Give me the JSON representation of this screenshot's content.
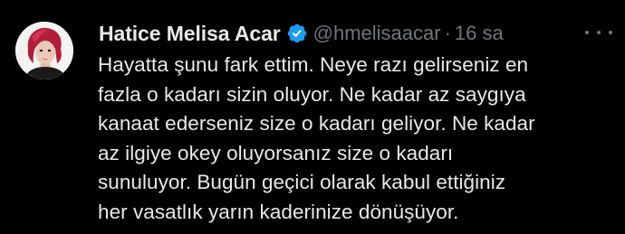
{
  "tweet": {
    "display_name": "Hatice Melisa Acar",
    "verified": true,
    "handle": "@hmelisaacar",
    "separator": "·",
    "time": "16 sa",
    "more_icon": "more-horizontal-icon",
    "text": "Hayatta şunu fark ettim. Neye razı gelirseniz en\nfazla o kadarı sizin oluyor. Ne kadar az saygıya\nkanaat ederseniz size o kadarı geliyor. Ne kadar\naz ilgiye okey oluyorsanız size o kadarı\nsunuluyor. Bugün geçici olarak kabul ettiğiniz\nher vasatlık yarın kaderinize dönüşüyor."
  },
  "colors": {
    "background": "#000000",
    "primary_text": "#e7e9ea",
    "secondary_text": "#71767b",
    "verified_badge": "#1d9bf0"
  }
}
